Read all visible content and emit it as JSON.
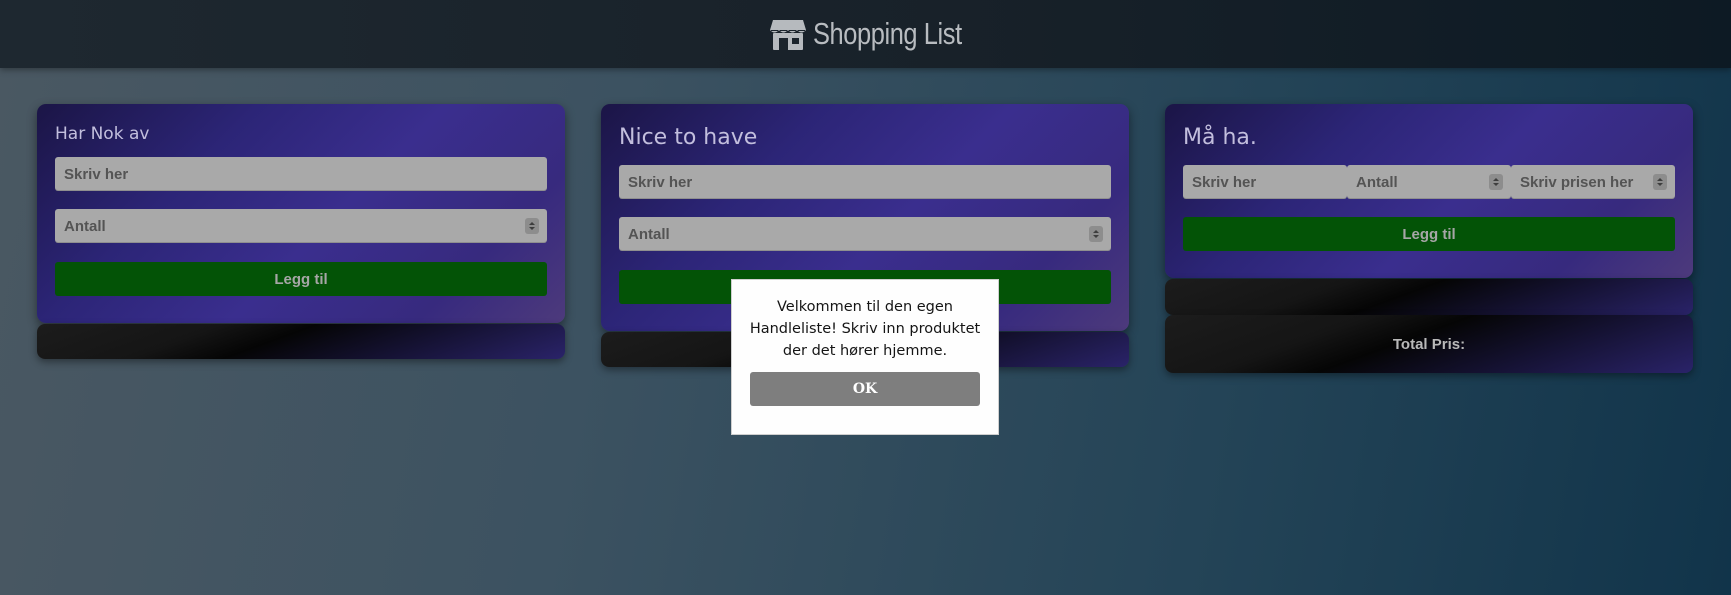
{
  "header": {
    "title": "Shopping List",
    "icon": "store-icon"
  },
  "lists": [
    {
      "title": "Har Nok av",
      "item_placeholder": "Skriv her",
      "qty_placeholder": "Antall",
      "add_label": "Legg til"
    },
    {
      "title": "Nice to have",
      "item_placeholder": "Skriv her",
      "qty_placeholder": "Antall",
      "add_label": "Legg til"
    },
    {
      "title": "Må ha.",
      "item_placeholder": "Skriv her",
      "qty_placeholder": "Antall",
      "price_placeholder": "Skriv prisen her",
      "add_label": "Legg til",
      "total_label": "Total Pris:"
    }
  ],
  "modal": {
    "message": "Velkommen til den egen Handleliste! Skriv inn produktet der det hører hjemme.",
    "ok_label": "OK"
  },
  "colors": {
    "accent_button": "#035306",
    "input_bg": "#a9a9a9",
    "card_accent": "#3a2e8e"
  }
}
